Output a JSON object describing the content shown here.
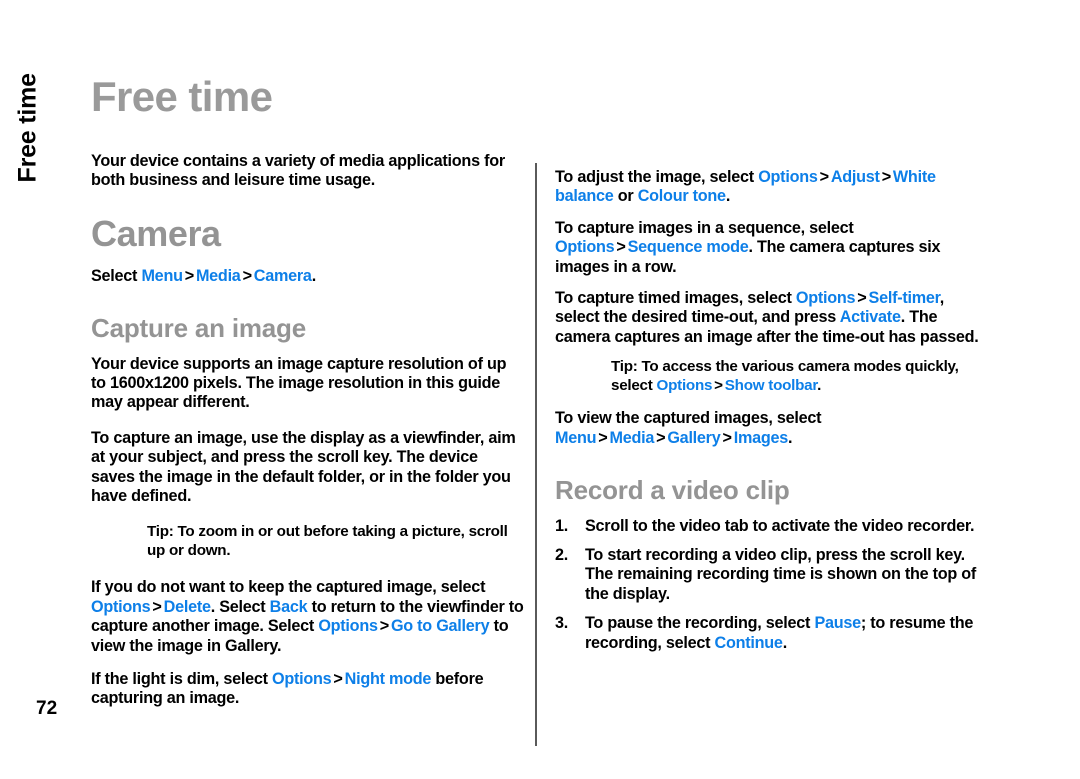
{
  "chapter_tab": {
    "label": "Free time"
  },
  "page_number": "72",
  "page_title": "Free time",
  "colors": {
    "link": "#0d7fe8",
    "heading_gray": "#949494",
    "text": "#000000",
    "divider": "#5a5a5a",
    "background": "#ffffff"
  },
  "left_column": {
    "intro_paragraph": "Your device contains a variety of media applications for both business and leisure time usage.",
    "camera_heading": "Camera",
    "select_line": {
      "prefix": "Select ",
      "link1": "Menu",
      "sep1": ">",
      "link2": "Media",
      "sep2": ">",
      "link3": "Camera",
      "suffix": "."
    },
    "capture_heading": "Capture an image",
    "para_resolution": "Your device supports an image capture resolution of up to 1600x1200 pixels. The image resolution in this guide may appear different.",
    "para_viewfinder": "To capture an image, use the display as a viewfinder, aim at your subject, and press the scroll key. The device saves the image in the default folder, or in the folder you have defined.",
    "tip_zoom": {
      "label": "Tip:",
      "text": " To zoom in or out before taking a picture, scroll up or down."
    },
    "para_delete": {
      "s1": "If you do not want to keep the captured image, select ",
      "l1": "Options",
      "sep1": ">",
      "l2": "Delete",
      "s2": ". Select ",
      "l3": "Back",
      "s3": " to return to the viewfinder to capture another image. Select ",
      "l4": "Options",
      "sep2": ">",
      "l5": "Go to Gallery",
      "s4": " to view the image in Gallery."
    },
    "para_night": {
      "s1": "If the light is dim, select ",
      "l1": "Options",
      "sep1": ">",
      "l2": "Night mode",
      "s2": " before capturing an image."
    }
  },
  "right_column": {
    "para_adjust": {
      "s1": "To adjust the image, select ",
      "l1": "Options",
      "sep1": ">",
      "l2": "Adjust",
      "sep2": ">",
      "l3": "White balance",
      "s2": " or ",
      "l4": "Colour tone",
      "s3": "."
    },
    "para_sequence": {
      "s1": "To capture images in a sequence, select ",
      "l1": "Options",
      "sep1": ">",
      "l2": "Sequence mode",
      "s2": ". The camera captures six images in a row."
    },
    "para_timer": {
      "s1": "To capture timed images, select ",
      "l1": "Options",
      "sep1": ">",
      "l2": "Self-timer",
      "s2": ", select the desired time-out, and press ",
      "l3": "Activate",
      "s3": ". The camera captures an image after the time-out has passed."
    },
    "tip_toolbar": {
      "label": "Tip:",
      "s1": " To access the various camera modes quickly, select ",
      "l1": "Options",
      "sep1": ">",
      "l2": "Show toolbar",
      "s2": "."
    },
    "para_gallery": {
      "s1": "To view the captured images, select ",
      "l1": "Menu",
      "sep1": ">",
      "l2": "Media",
      "sep2": ">",
      "l3": "Gallery",
      "sep3": ">",
      "l4": "Images",
      "s2": "."
    },
    "record_heading": "Record a video clip",
    "steps": [
      {
        "num": "1.",
        "s1": "Scroll to the video tab to activate the video recorder."
      },
      {
        "num": "2.",
        "s1": "To start recording a video clip, press the scroll key. The remaining recording time is shown on the top of the display."
      },
      {
        "num": "3.",
        "s1": "To pause the recording, select ",
        "l1": "Pause",
        "s2": "; to resume the recording, select ",
        "l2": "Continue",
        "s3": "."
      }
    ]
  }
}
